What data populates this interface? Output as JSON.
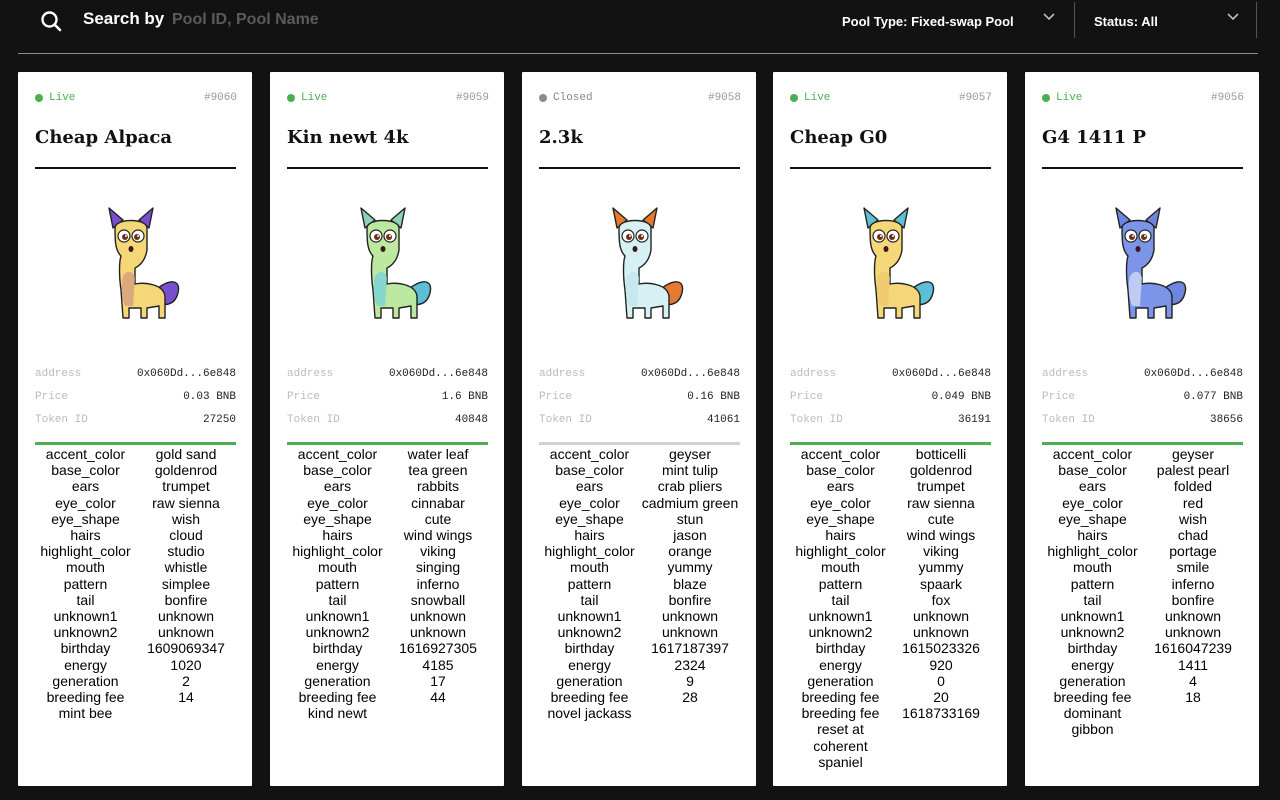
{
  "search": {
    "label": "Search by",
    "placeholder": "Pool ID, Pool Name",
    "icon": "search-icon"
  },
  "filters": {
    "pool_type": {
      "label": "Pool Type: Fixed-swap Pool",
      "icon": "chevron-down-icon"
    },
    "status": {
      "label": "Status: All",
      "icon": "chevron-down-icon"
    }
  },
  "colors": {
    "live": "#4caf50",
    "closed": "#8a8a8a",
    "closed_bar": "#d0d0d8",
    "background": "#121212"
  },
  "labels": {
    "address": "address",
    "price": "Price",
    "token_id": "Token ID"
  },
  "cards": [
    {
      "status": "Live",
      "pool_id": "#9060",
      "name": "Cheap Alpaca",
      "address": "0x060Dd...6e848",
      "price": "0.03 BNB",
      "token_id": "27250",
      "kitty_colors": {
        "body": "#f6d777",
        "belly": "#d8a07e",
        "ears": "#7a4fcf",
        "tail": "#7a4fcf"
      },
      "attributes": [
        {
          "key": "accent_color",
          "value": "gold sand"
        },
        {
          "key": "base_color",
          "value": "goldenrod"
        },
        {
          "key": "ears",
          "value": "trumpet"
        },
        {
          "key": "eye_color",
          "value": "raw sienna"
        },
        {
          "key": "eye_shape",
          "value": "wish"
        },
        {
          "key": "hairs",
          "value": "cloud"
        },
        {
          "key": "highlight_color",
          "value": "studio"
        },
        {
          "key": "mouth",
          "value": "whistle"
        },
        {
          "key": "pattern",
          "value": "simplee"
        },
        {
          "key": "tail",
          "value": "bonfire"
        },
        {
          "key": "unknown1",
          "value": "unknown"
        },
        {
          "key": "unknown2",
          "value": "unknown"
        },
        {
          "key": "birthday",
          "value": "1609069347"
        },
        {
          "key": "energy",
          "value": "1020"
        },
        {
          "key": "generation",
          "value": "2"
        },
        {
          "key": "breeding fee",
          "value": "14"
        },
        {
          "key": "mint bee",
          "value": ""
        }
      ]
    },
    {
      "status": "Live",
      "pool_id": "#9059",
      "name": "Kin newt 4k",
      "address": "0x060Dd...6e848",
      "price": "1.6 BNB",
      "token_id": "40848",
      "kitty_colors": {
        "body": "#bde8a0",
        "belly": "#7fd3d6",
        "ears": "#8fd1b3",
        "tail": "#5bbfd6"
      },
      "attributes": [
        {
          "key": "accent_color",
          "value": "water leaf"
        },
        {
          "key": "base_color",
          "value": "tea green"
        },
        {
          "key": "ears",
          "value": "rabbits"
        },
        {
          "key": "eye_color",
          "value": "cinnabar"
        },
        {
          "key": "eye_shape",
          "value": "cute"
        },
        {
          "key": "hairs",
          "value": "wind wings"
        },
        {
          "key": "highlight_color",
          "value": "viking"
        },
        {
          "key": "mouth",
          "value": "singing"
        },
        {
          "key": "pattern",
          "value": "inferno"
        },
        {
          "key": "tail",
          "value": "snowball"
        },
        {
          "key": "unknown1",
          "value": "unknown"
        },
        {
          "key": "unknown2",
          "value": "unknown"
        },
        {
          "key": "birthday",
          "value": "1616927305"
        },
        {
          "key": "energy",
          "value": "4185"
        },
        {
          "key": "generation",
          "value": "17"
        },
        {
          "key": "breeding fee",
          "value": "44"
        },
        {
          "key": "kind newt",
          "value": ""
        }
      ]
    },
    {
      "status": "Closed",
      "pool_id": "#9058",
      "name": "2.3k",
      "address": "0x060Dd...6e848",
      "price": "0.16 BNB",
      "token_id": "41061",
      "kitty_colors": {
        "body": "#d6f1f3",
        "belly": "#c3e8ef",
        "ears": "#e6782f",
        "tail": "#e6782f"
      },
      "attributes": [
        {
          "key": "accent_color",
          "value": "geyser"
        },
        {
          "key": "base_color",
          "value": "mint tulip"
        },
        {
          "key": "ears",
          "value": "crab pliers"
        },
        {
          "key": "eye_color",
          "value": "cadmium green"
        },
        {
          "key": "eye_shape",
          "value": "stun"
        },
        {
          "key": "hairs",
          "value": "jason"
        },
        {
          "key": "highlight_color",
          "value": "orange"
        },
        {
          "key": "mouth",
          "value": "yummy"
        },
        {
          "key": "pattern",
          "value": "blaze"
        },
        {
          "key": "tail",
          "value": "bonfire"
        },
        {
          "key": "unknown1",
          "value": "unknown"
        },
        {
          "key": "unknown2",
          "value": "unknown"
        },
        {
          "key": "birthday",
          "value": "1617187397"
        },
        {
          "key": "energy",
          "value": "2324"
        },
        {
          "key": "generation",
          "value": "9"
        },
        {
          "key": "breeding fee",
          "value": "28"
        },
        {
          "key": "novel jackass",
          "value": ""
        }
      ]
    },
    {
      "status": "Live",
      "pool_id": "#9057",
      "name": "Cheap G0",
      "address": "0x060Dd...6e848",
      "price": "0.049 BNB",
      "token_id": "36191",
      "kitty_colors": {
        "body": "#f6d777",
        "belly": "#f0c970",
        "ears": "#5bbfd6",
        "tail": "#5bbfd6"
      },
      "attributes": [
        {
          "key": "accent_color",
          "value": "botticelli"
        },
        {
          "key": "base_color",
          "value": "goldenrod"
        },
        {
          "key": "ears",
          "value": "trumpet"
        },
        {
          "key": "eye_color",
          "value": "raw sienna"
        },
        {
          "key": "eye_shape",
          "value": "cute"
        },
        {
          "key": "hairs",
          "value": "wind wings"
        },
        {
          "key": "highlight_color",
          "value": "viking"
        },
        {
          "key": "mouth",
          "value": "yummy"
        },
        {
          "key": "pattern",
          "value": "spaark"
        },
        {
          "key": "tail",
          "value": "fox"
        },
        {
          "key": "unknown1",
          "value": "unknown"
        },
        {
          "key": "unknown2",
          "value": "unknown"
        },
        {
          "key": "birthday",
          "value": "1615023326"
        },
        {
          "key": "energy",
          "value": "920"
        },
        {
          "key": "generation",
          "value": "0"
        },
        {
          "key": "breeding fee",
          "value": "20"
        },
        {
          "key": "breeding fee",
          "value": "1618733169"
        },
        {
          "key": "reset at coherent spaniel",
          "value": ""
        }
      ]
    },
    {
      "status": "Live",
      "pool_id": "#9056",
      "name": "G4 1411 P",
      "address": "0x060Dd...6e848",
      "price": "0.077 BNB",
      "token_id": "38656",
      "kitty_colors": {
        "body": "#7d95e8",
        "belly": "#c9d6f5",
        "ears": "#6f86de",
        "tail": "#6f86de"
      },
      "attributes": [
        {
          "key": "accent_color",
          "value": "geyser"
        },
        {
          "key": "base_color",
          "value": "palest pearl"
        },
        {
          "key": "ears",
          "value": "folded"
        },
        {
          "key": "eye_color",
          "value": "red"
        },
        {
          "key": "eye_shape",
          "value": "wish"
        },
        {
          "key": "hairs",
          "value": "chad"
        },
        {
          "key": "highlight_color",
          "value": "portage"
        },
        {
          "key": "mouth",
          "value": "smile"
        },
        {
          "key": "pattern",
          "value": "inferno"
        },
        {
          "key": "tail",
          "value": "bonfire"
        },
        {
          "key": "unknown1",
          "value": "unknown"
        },
        {
          "key": "unknown2",
          "value": "unknown"
        },
        {
          "key": "birthday",
          "value": "1616047239"
        },
        {
          "key": "energy",
          "value": "1411"
        },
        {
          "key": "generation",
          "value": "4"
        },
        {
          "key": "breeding fee",
          "value": "18"
        },
        {
          "key": "dominant gibbon",
          "value": ""
        }
      ]
    }
  ]
}
